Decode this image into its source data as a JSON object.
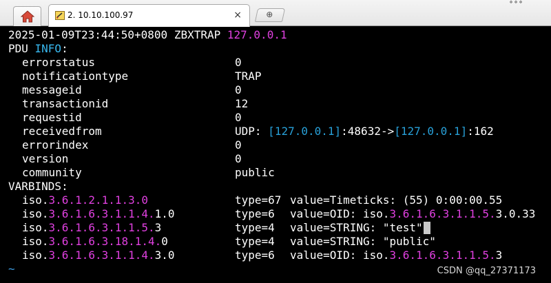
{
  "tabs": {
    "home_icon": "home-icon",
    "session": {
      "icon": "terminal-session-icon",
      "title": "2. 10.10.100.97",
      "close": "×"
    },
    "new_tab_icon": "plus-icon",
    "new_tab_glyph": "⊕"
  },
  "terminal": {
    "header": {
      "timestamp": "2025-01-09T23:44:50+0800 ZBXTRAP ",
      "ip": "127.0.0.1"
    },
    "pdu": {
      "label_a": "PDU ",
      "label_b": "INFO",
      "label_c": ":",
      "fields": [
        {
          "key": "errorstatus",
          "value": "0"
        },
        {
          "key": "notificationtype",
          "value": "TRAP"
        },
        {
          "key": "messageid",
          "value": "0"
        },
        {
          "key": "transactionid",
          "value": "12"
        },
        {
          "key": "requestid",
          "value": "0"
        },
        {
          "key": "receivedfrom",
          "value": ""
        },
        {
          "key": "errorindex",
          "value": "0"
        },
        {
          "key": "version",
          "value": "0"
        },
        {
          "key": "community",
          "value": "public"
        }
      ],
      "receivedfrom": {
        "p1": "UDP: ",
        "b1": "[",
        "ip1": "127.0.0.1",
        "b2": "]",
        "p2": ":48632->",
        "b3": "[",
        "ip2": "127.0.0.1",
        "b4": "]",
        "p3": ":162"
      }
    },
    "varbinds": {
      "label": "VARBINDS:",
      "rows": [
        {
          "pre": "iso.",
          "oid": "3.6.1.2.1.1.3.0",
          "oid_suffix": "",
          "type": "type=67",
          "value_pre": "value=Timeticks: (55) 0:00:00.55",
          "value_oid": "",
          "value_post": ""
        },
        {
          "pre": "iso.",
          "oid": "3.6.1.6.3.1.1.4.",
          "oid_suffix": "1.0",
          "type": "type=6 ",
          "value_pre": "value=OID: iso.",
          "value_oid": "3.6.1.6.3.1.1.5.",
          "value_post": "3.0.33"
        },
        {
          "pre": "iso.",
          "oid": "3.6.1.6.3.1.1.5.",
          "oid_suffix": "3",
          "type": "type=4 ",
          "value_pre": "value=STRING: \"test\"",
          "value_oid": "",
          "value_post": ""
        },
        {
          "pre": "iso.",
          "oid": "3.6.1.6.3.18.1.4.",
          "oid_suffix": "0",
          "type": "type=4 ",
          "value_pre": "value=STRING: \"public\"",
          "value_oid": "",
          "value_post": ""
        },
        {
          "pre": "iso.",
          "oid": "3.6.1.6.3.1.1.4.",
          "oid_suffix": "3.0",
          "type": "type=6 ",
          "value_pre": "value=OID: iso.",
          "value_oid": "3.6.1.6.3.1.1.5.",
          "value_post": "3"
        }
      ]
    },
    "prompt": "~"
  },
  "watermark": "CSDN @qq_27371173",
  "colors": {
    "background": "#000000",
    "text": "#ffffff",
    "ip_magenta": "#e040e0",
    "keyword_cyan": "#38b8ef",
    "bracket_blue": "#28a0d8",
    "cursor": "#c8c8c8"
  }
}
